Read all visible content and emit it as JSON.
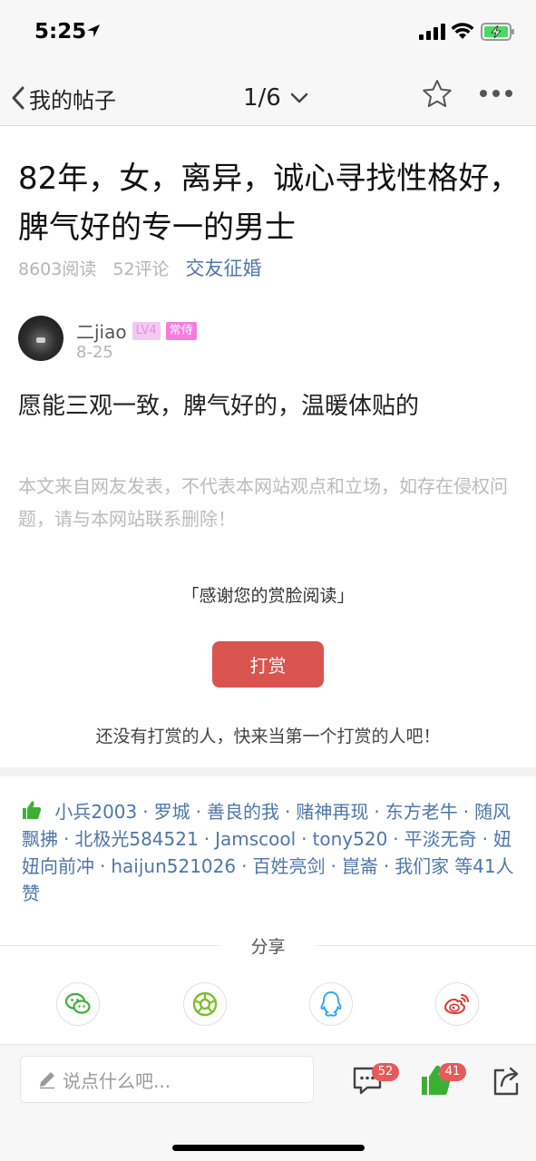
{
  "status_bar": {
    "time": "5:25",
    "icons": [
      "location-arrow-icon",
      "signal-icon",
      "wifi-icon",
      "battery-charging-icon"
    ]
  },
  "nav": {
    "back_label": "我的帖子",
    "page_indicator": "1/6",
    "icons": [
      "chevron-left-icon",
      "chevron-down-icon",
      "star-icon",
      "more-icon"
    ]
  },
  "post": {
    "title": "82年，女，离异，诚心寻找性格好，脾气好的专一的男士",
    "reads": "8603阅读",
    "comments": "52评论",
    "category": "交友征婚",
    "author": {
      "name": "二jiao",
      "level": "LV4",
      "tag": "常侍",
      "date": "8-25"
    },
    "body": "愿能三观一致，脾气好的，温暖体贴的",
    "disclaimer": "本文来自网友发表，不代表本网站观点和立场，如存在侵权问题，请与本网站联系删除！"
  },
  "reward": {
    "thanks_text": "「感谢您的赏脸阅读」",
    "button_label": "打赏",
    "empty_text": "还没有打赏的人，快来当第一个打赏的人吧！"
  },
  "likes": {
    "users": [
      "小兵2003",
      "罗城",
      "善良的我",
      "赌神再现",
      "东方老牛",
      "随风飘拂",
      "北极光584521",
      "Jamscool",
      "tony520",
      "平淡无奇",
      "妞妞向前冲",
      "haijun521026",
      "百姓亮剑",
      "崑崙",
      "我们家"
    ],
    "summary": "等41人赞"
  },
  "share": {
    "label": "分享",
    "targets": [
      "wechat-icon",
      "moments-icon",
      "qq-icon",
      "weibo-icon"
    ],
    "colors": {
      "wechat": "#3cb035",
      "moments": "#7bbf2b",
      "qq": "#35a7e8",
      "weibo": "#e0342e"
    }
  },
  "bottom_bar": {
    "comment_placeholder": "说点什么吧...",
    "comment_count": "52",
    "like_count": "41"
  },
  "colors": {
    "accent_blue": "#4f76a9",
    "reward_red": "#d9534f",
    "like_green": "#3cb035",
    "badge_red": "#e75a5a"
  }
}
